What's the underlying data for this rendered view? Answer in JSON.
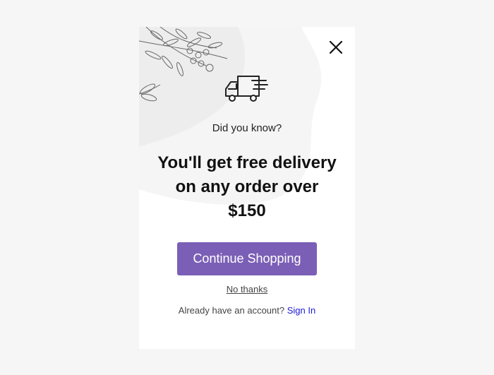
{
  "popup": {
    "eyebrow": "Did you know?",
    "headline": [
      "You'll get free delivery",
      "on any order over",
      "$150"
    ],
    "cta_label": "Continue Shopping",
    "dismiss_label": "No thanks",
    "account_prompt": "Already have an account?",
    "signin_label": "Sign In"
  },
  "icons": {
    "close": "close-icon",
    "truck": "delivery-truck-icon",
    "decoration": "foliage-branch-illustration"
  },
  "colors": {
    "accent": "#7b5fb6",
    "link": "#1a1ad4",
    "background": "#f6f6f6"
  }
}
